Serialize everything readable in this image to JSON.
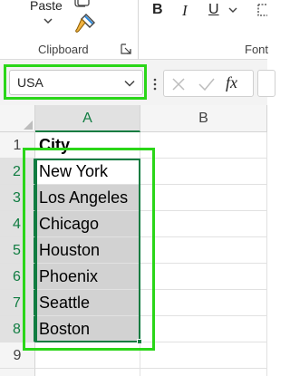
{
  "ribbon": {
    "paste_label": "Paste",
    "clipboard_group": "Clipboard",
    "font_group": "Font",
    "bold": "B",
    "italic": "I",
    "underline": "U"
  },
  "namebox": {
    "value": "USA"
  },
  "formula_bar": {
    "fx_label": "fx"
  },
  "columns": [
    "A",
    "B"
  ],
  "rows": [
    "1",
    "2",
    "3",
    "4",
    "5",
    "6",
    "7",
    "8",
    "9"
  ],
  "cells": {
    "header": "City",
    "cities": [
      "New York",
      "Los Angeles",
      "Chicago",
      "Houston",
      "Phoenix",
      "Seattle",
      "Boston"
    ]
  },
  "colors": {
    "accent": "#107c41",
    "highlight_box": "#2ad618",
    "selection_fill": "#d2d2d2"
  }
}
